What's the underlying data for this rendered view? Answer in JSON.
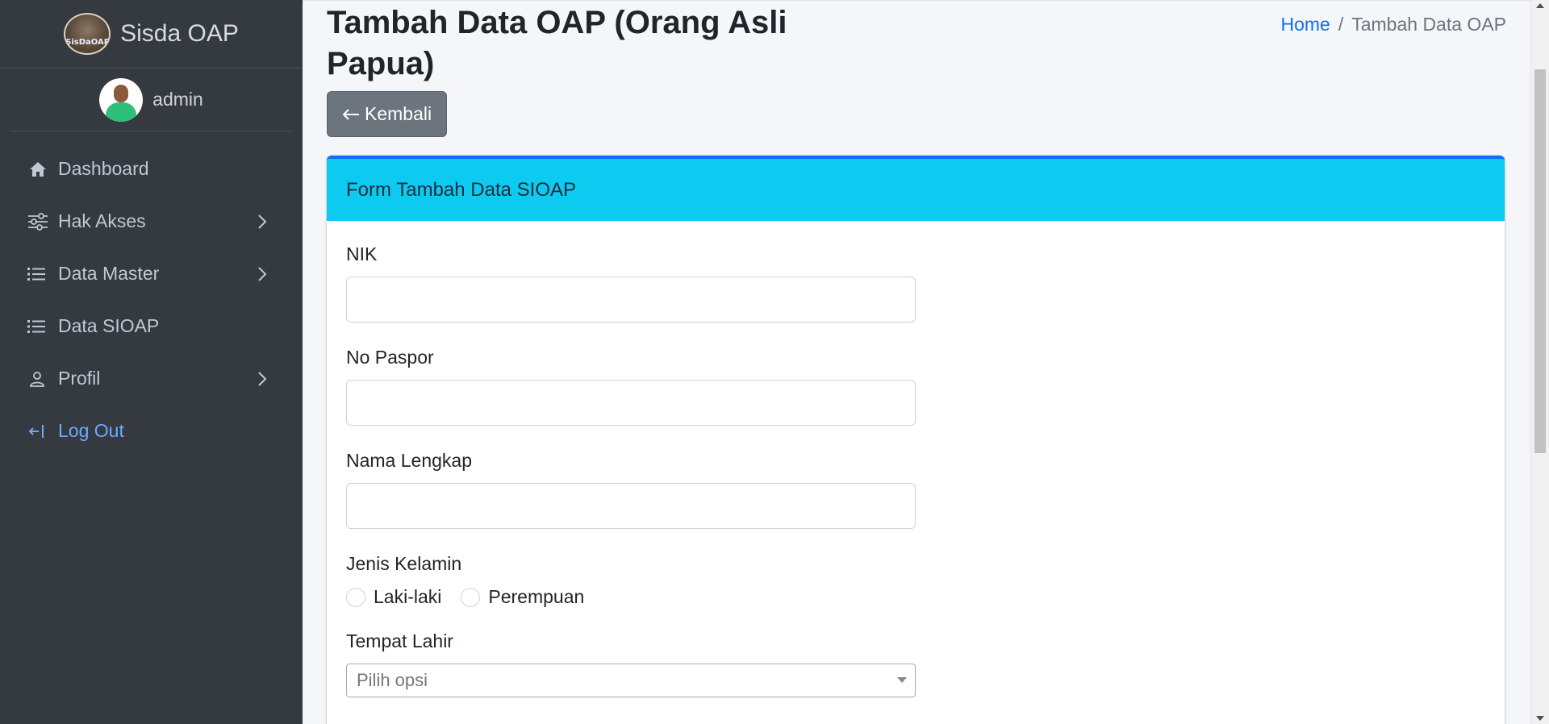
{
  "sidebar": {
    "brand": {
      "logo_text": "SisDaOAP",
      "title": "Sisda OAP"
    },
    "user": {
      "name": "admin"
    },
    "items": [
      {
        "label": "Dashboard",
        "icon": "home-icon",
        "has_chevron": false
      },
      {
        "label": "Hak Akses",
        "icon": "sliders-icon",
        "has_chevron": true
      },
      {
        "label": "Data Master",
        "icon": "list-icon",
        "has_chevron": true
      },
      {
        "label": "Data SIOAP",
        "icon": "list-icon",
        "has_chevron": false
      },
      {
        "label": "Profil",
        "icon": "person-icon",
        "has_chevron": true
      },
      {
        "label": "Log Out",
        "icon": "logout-icon",
        "has_chevron": false
      }
    ]
  },
  "header": {
    "title": "Tambah Data OAP (Orang Asli Papua)",
    "breadcrumb": {
      "home": "Home",
      "separator": "/",
      "current": "Tambah Data OAP"
    }
  },
  "toolbar": {
    "back_label": "Kembali"
  },
  "form": {
    "card_title": "Form Tambah Data SIOAP",
    "fields": {
      "nik": {
        "label": "NIK",
        "value": ""
      },
      "paspor": {
        "label": "No Paspor",
        "value": ""
      },
      "nama": {
        "label": "Nama Lengkap",
        "value": ""
      },
      "jenis_kelamin": {
        "label": "Jenis Kelamin",
        "options": [
          "Laki-laki",
          "Perempuan"
        ],
        "selected": null
      },
      "tempat_lahir": {
        "label": "Tempat Lahir",
        "placeholder": "Pilih opsi"
      }
    }
  },
  "colors": {
    "sidebar_bg": "#343a40",
    "header_bg": "#0dcaf0",
    "card_border_top": "#0d6efd",
    "link": "#0d6efd",
    "logout": "#6ea8fe",
    "button_secondary": "#6c757d"
  }
}
